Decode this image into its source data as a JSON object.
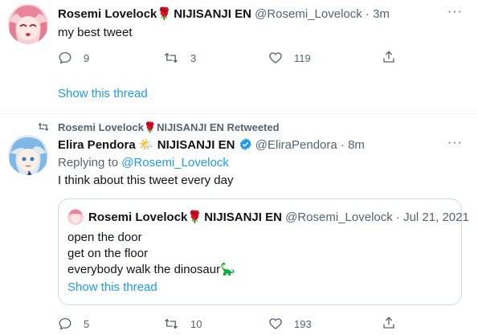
{
  "tweet1": {
    "display_name": "Rosemi Lovelock",
    "rose": "🌹",
    "affiliation": "NIJISANJI EN",
    "handle": "@Rosemi_Lovelock",
    "sep": "·",
    "time": "3m",
    "text": "my best tweet",
    "replies": "9",
    "retweets": "3",
    "likes": "119",
    "show_thread": "Show this thread",
    "more": "···"
  },
  "tweet2": {
    "retweet_context": "Rosemi Lovelock🌹NIJISANJI EN Retweeted",
    "display_name": "Elira Pendora",
    "sun": "🌤️",
    "affiliation": "NIJISANJI EN",
    "handle": "@EliraPendora",
    "sep": "·",
    "time": "8m",
    "replying_prefix": "Replying to",
    "replying_handle": "@Rosemi_Lovelock",
    "text": "I think about this tweet every day",
    "more": "···",
    "quote": {
      "display_name": "Rosemi Lovelock",
      "rose": "🌹",
      "affiliation": "NIJISANJI EN",
      "handle": "@Rosemi_Lovelock",
      "sep": "·",
      "date": "Jul 21, 2021",
      "lines": [
        "open the door",
        "get on the floor",
        "everybody walk the dinosaur"
      ],
      "dino": "🦕",
      "show_thread": "Show this thread"
    },
    "replies": "5",
    "retweets": "10",
    "likes": "193"
  },
  "colors": {
    "accent": "#1d9bf0",
    "muted": "#536471",
    "text": "#0f1419",
    "rose": "#c4132b",
    "border": "#cfd9de"
  }
}
